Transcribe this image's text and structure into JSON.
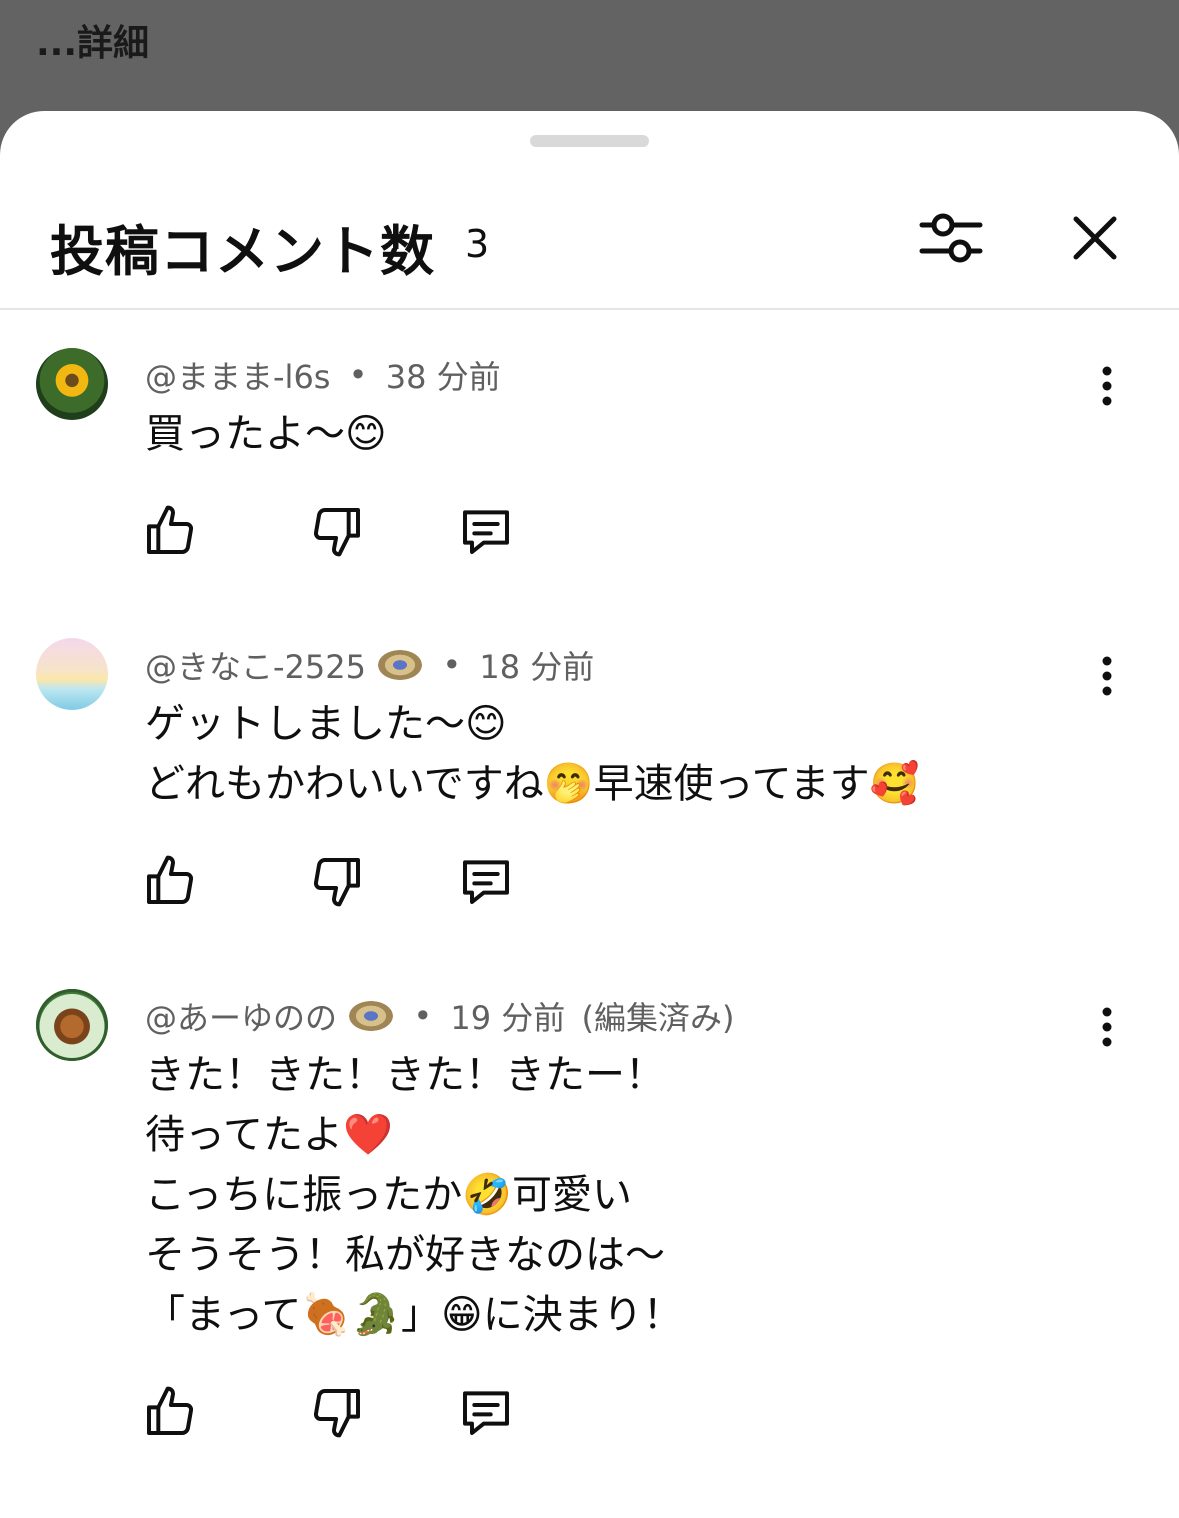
{
  "background": {
    "details_link": "...詳細"
  },
  "header": {
    "title": "投稿コメント数",
    "count": "3",
    "filter_icon": "sliders-icon",
    "close_icon": "close-icon"
  },
  "comments": [
    {
      "author": "@ままま-l6s",
      "separator": "•",
      "time": "38 分前",
      "edited": "",
      "lines": [
        "買ったよ〜😊"
      ]
    },
    {
      "author": "@きなこ-2525",
      "separator": "•",
      "time": "18 分前",
      "edited": "",
      "lines": [
        "ゲットしました〜😊",
        "どれもかわいいですね🤭早速使ってます🥰"
      ]
    },
    {
      "author": "@あーゆのの",
      "separator": "•",
      "time": "19 分前",
      "edited": "(編集済み)",
      "lines": [
        "きた！きた！きた！きたー！",
        "待ってたよ❤️",
        "こっちに振ったか🤣可愛い",
        "そうそう！私が好きなのは〜",
        "「まって🍖🐊」😁に決まり！"
      ]
    }
  ],
  "actions": {
    "like_icon": "thumbs-up-icon",
    "dislike_icon": "thumbs-down-icon",
    "reply_icon": "comment-icon",
    "more_icon": "more-vertical-icon"
  }
}
